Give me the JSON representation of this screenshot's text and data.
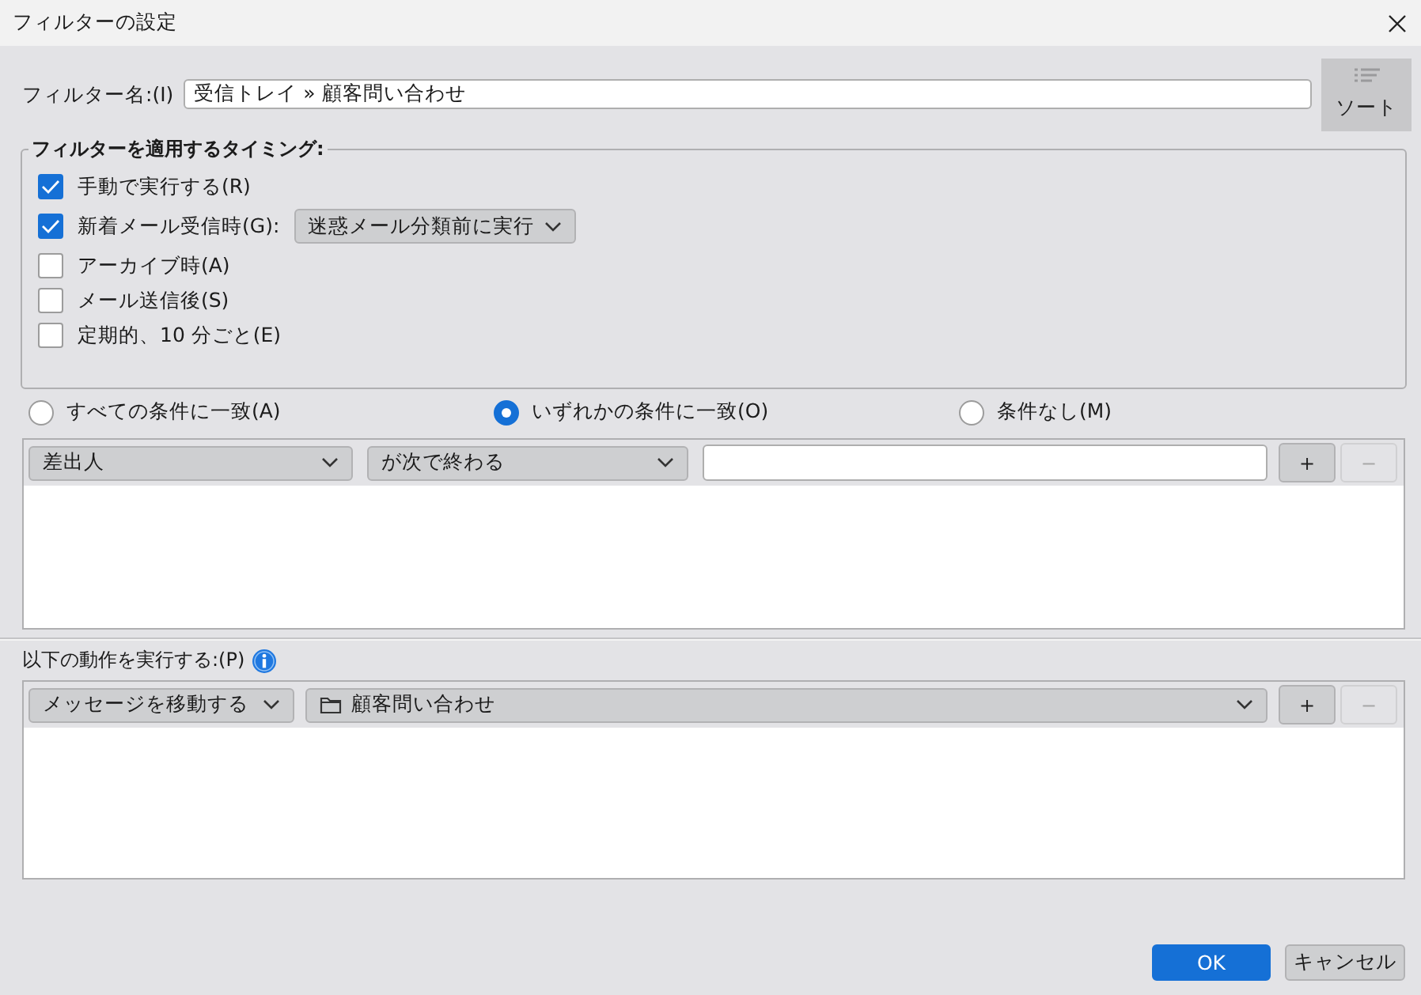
{
  "window": {
    "title": "フィルターの設定"
  },
  "filter_name": {
    "label": "フィルター名:(I)",
    "value": "受信トレイ » 顧客問い合わせ"
  },
  "sort_button": {
    "label": "ソート"
  },
  "timing": {
    "legend": "フィルターを適用するタイミング:",
    "options": [
      {
        "label": "手動で実行する(R)",
        "checked": true
      },
      {
        "label": "新着メール受信時(G):",
        "checked": true,
        "dropdown": "迷惑メール分類前に実行"
      },
      {
        "label": "アーカイブ時(A)",
        "checked": false
      },
      {
        "label": "メール送信後(S)",
        "checked": false
      },
      {
        "label": "定期的、10 分ごと(E)",
        "checked": false
      }
    ]
  },
  "match": [
    {
      "label": "すべての条件に一致(A)",
      "selected": false
    },
    {
      "label": "いずれかの条件に一致(O)",
      "selected": true
    },
    {
      "label": "条件なし(M)",
      "selected": false
    }
  ],
  "conditions": [
    {
      "field": "差出人",
      "operator": "が次で終わる",
      "buttons": [
        {
          "label": "+",
          "disabled": false
        },
        {
          "label": "−",
          "disabled": true
        }
      ]
    }
  ],
  "actions": {
    "label": "以下の動作を実行する:(P)",
    "rows": [
      {
        "action": "メッセージを移動する",
        "target": "顧客問い合わせ",
        "buttons": [
          {
            "label": "+",
            "disabled": false
          },
          {
            "label": "−",
            "disabled": true
          }
        ]
      }
    ]
  },
  "footer_buttons": [
    {
      "label": "OK",
      "kind": "primary"
    },
    {
      "label": "キャンセル",
      "kind": "secondary"
    }
  ]
}
